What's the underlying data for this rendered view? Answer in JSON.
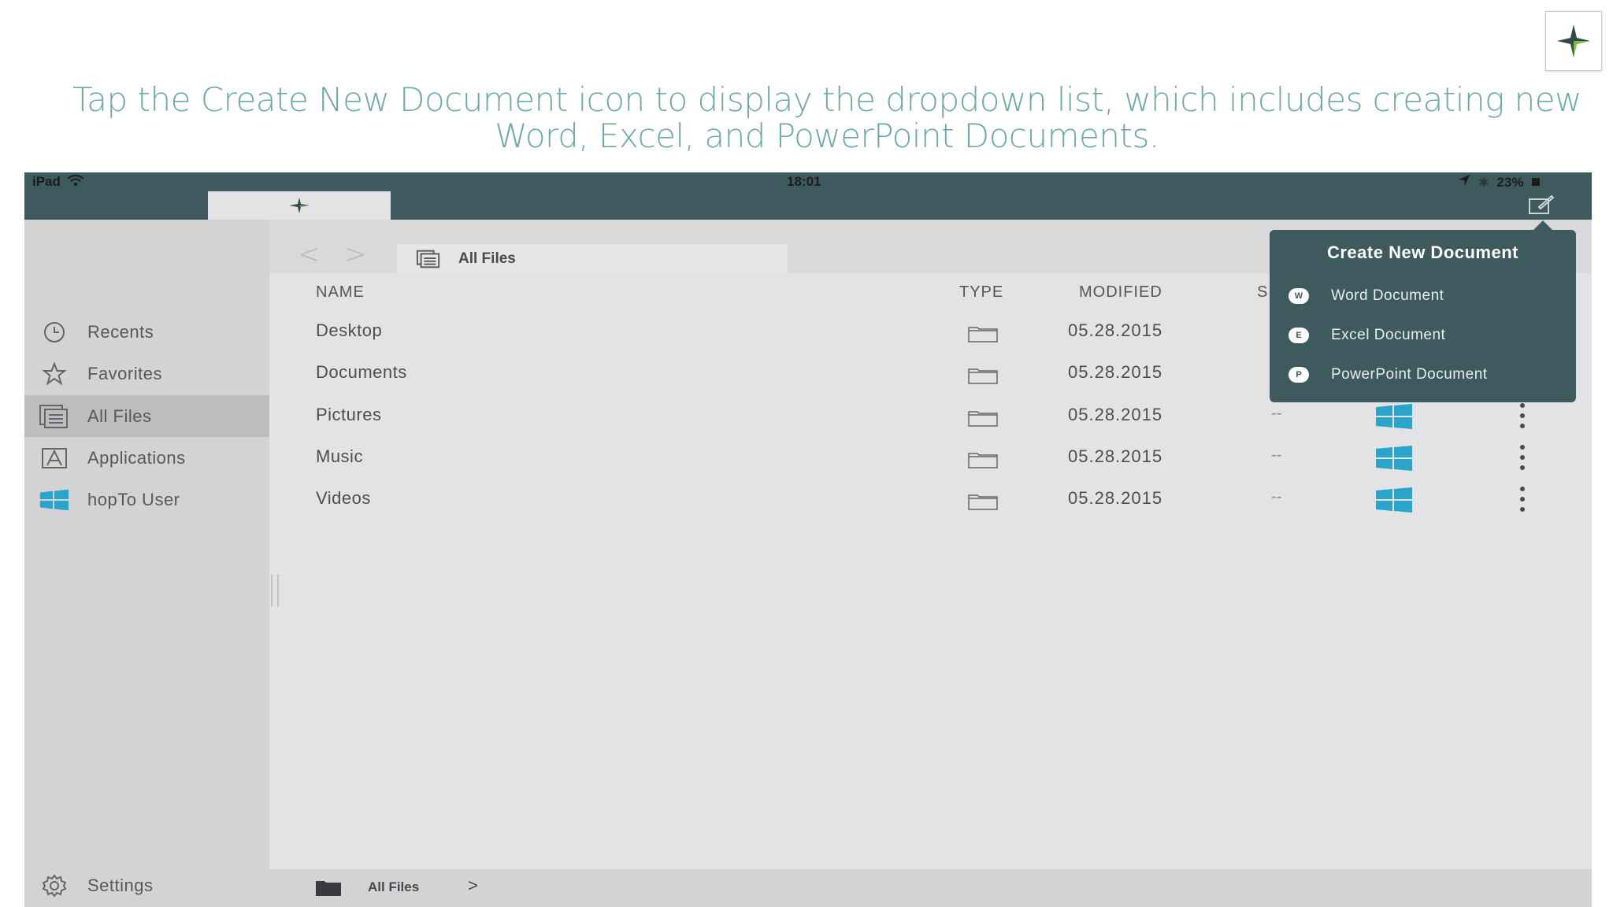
{
  "slide": {
    "caption": "Tap the Create New Document icon to display the dropdown list, which includes creating new Word, Excel, and PowerPoint Documents."
  },
  "status_bar": {
    "device": "iPad",
    "time": "18:01",
    "battery": "23%"
  },
  "sidebar": {
    "items": [
      {
        "label": "Recents",
        "icon": "clock-icon"
      },
      {
        "label": "Favorites",
        "icon": "star-icon"
      },
      {
        "label": "All Files",
        "icon": "all-files-icon",
        "active": true
      },
      {
        "label": "Applications",
        "icon": "applications-icon"
      },
      {
        "label": "hopTo User",
        "icon": "windows-icon"
      }
    ],
    "settings_label": "Settings"
  },
  "path": {
    "label": "All Files"
  },
  "table": {
    "columns": [
      "NAME",
      "TYPE",
      "MODIFIED",
      "S"
    ],
    "rows": [
      {
        "name": "Desktop",
        "modified": "05.28.2015",
        "size": ""
      },
      {
        "name": "Documents",
        "modified": "05.28.2015",
        "size": ""
      },
      {
        "name": "Pictures",
        "modified": "05.28.2015",
        "size": "--"
      },
      {
        "name": "Music",
        "modified": "05.28.2015",
        "size": "--"
      },
      {
        "name": "Videos",
        "modified": "05.28.2015",
        "size": "--"
      }
    ]
  },
  "dropdown": {
    "title": "Create New Document",
    "items": [
      {
        "badge": "W",
        "label": "Word Document"
      },
      {
        "badge": "E",
        "label": "Excel Document"
      },
      {
        "badge": "P",
        "label": "PowerPoint Document"
      }
    ]
  },
  "bottom_bar": {
    "label": "All Files",
    "chevron": ">"
  },
  "colors": {
    "caption": "#6fa8a8",
    "topbar": "#3e5a5e",
    "windows_blue": "#2aa4c9"
  }
}
